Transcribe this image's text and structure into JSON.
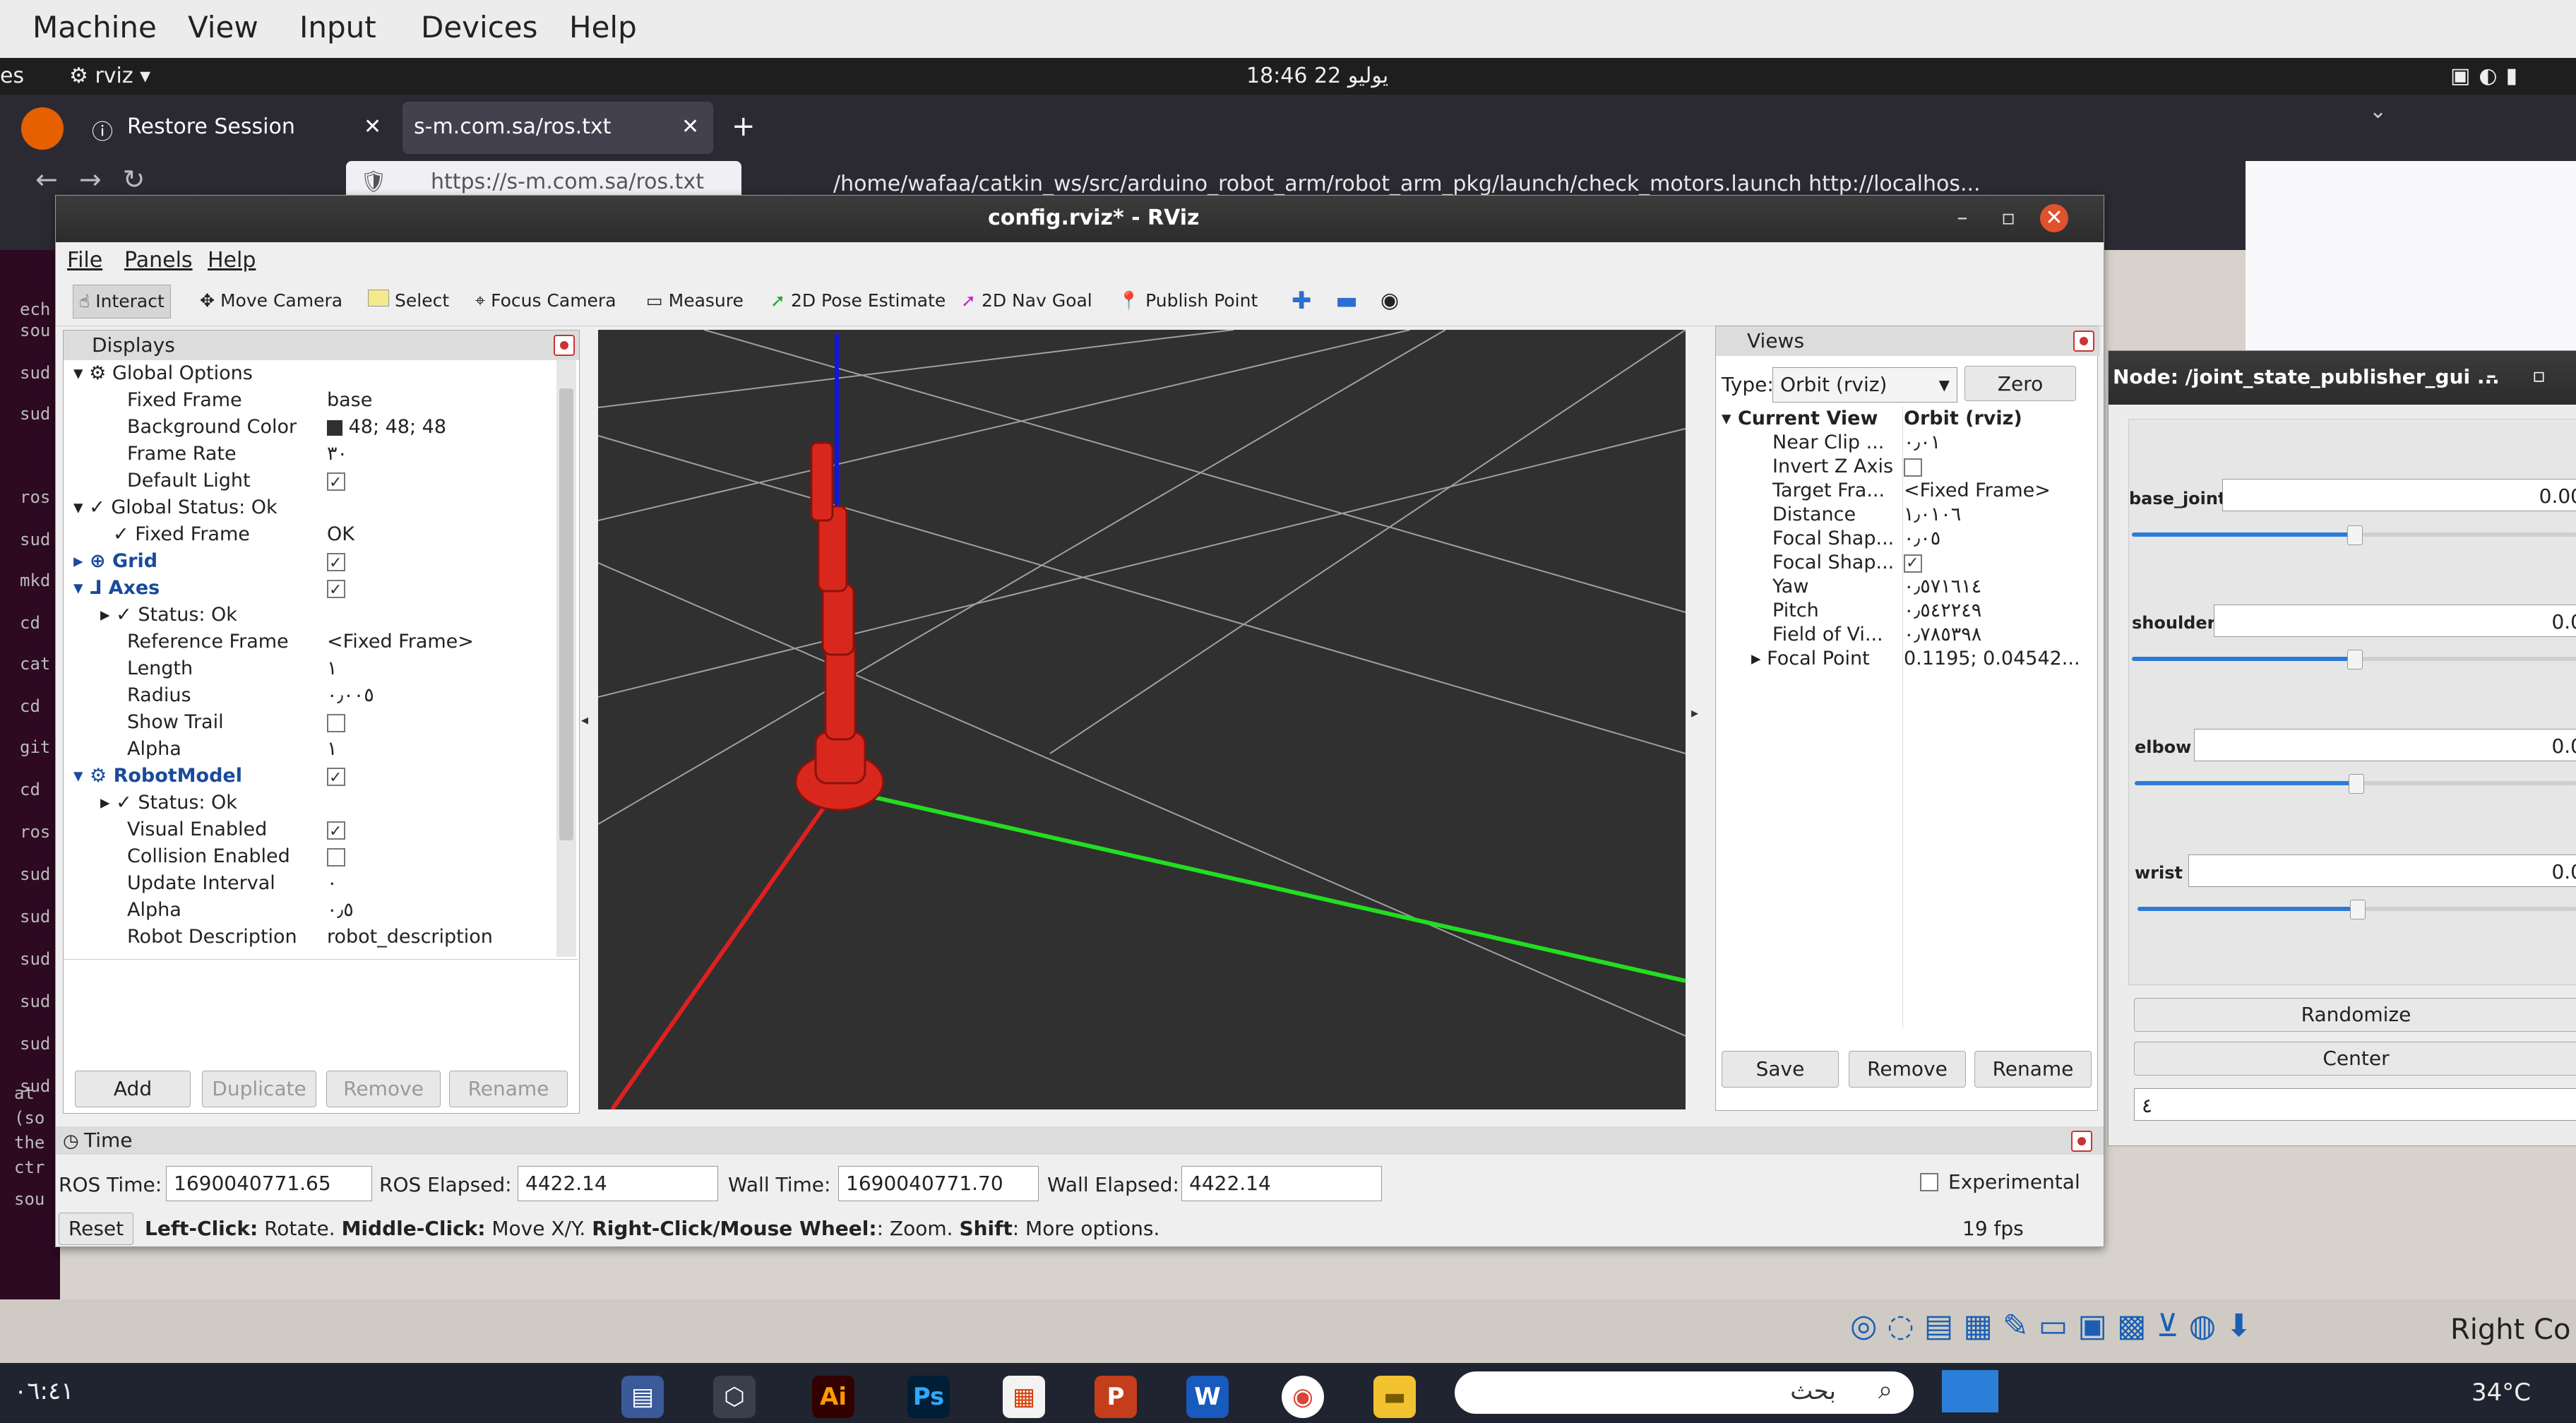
{
  "vm_menu": [
    "Machine",
    "View",
    "Input",
    "Devices",
    "Help"
  ],
  "ubuntu_bar": {
    "left_text": "es",
    "app": "rviz",
    "clock": "18:46 22 يوليو"
  },
  "firefox": {
    "tabs": [
      {
        "label": "Restore Session"
      },
      {
        "label": "s-m.com.sa/ros.txt"
      }
    ],
    "url": "https://s-m.com.sa/ros.txt",
    "path_title": "/home/wafaa/catkin_ws/src/arduino_robot_arm/robot_arm_pkg/launch/check_motors.launch http://localhos..."
  },
  "terminal_lines": [
    "ech",
    "sou",
    "sud",
    "sud",
    "ros",
    "sud",
    "mkd",
    "cd",
    "cat",
    "cd",
    "git",
    "cd",
    "ros",
    "sud",
    "sud",
    "sud",
    "sud",
    "sud",
    "sud",
    "at",
    "(so",
    "the",
    "ctr",
    "sou"
  ],
  "rviz": {
    "title": "config.rviz* - RViz",
    "menu": [
      "File",
      "Panels",
      "Help"
    ],
    "tools": [
      {
        "label": "Interact",
        "icon": "hand-icon"
      },
      {
        "label": "Move Camera",
        "icon": "move-camera-icon"
      },
      {
        "label": "Select",
        "icon": "select-icon"
      },
      {
        "label": "Focus Camera",
        "icon": "focus-icon"
      },
      {
        "label": "Measure",
        "icon": "ruler-icon"
      },
      {
        "label": "2D Pose Estimate",
        "icon": "pose-arrow-icon"
      },
      {
        "label": "2D Nav Goal",
        "icon": "nav-arrow-icon"
      },
      {
        "label": "Publish Point",
        "icon": "pin-icon"
      }
    ],
    "displays": {
      "title": "Displays",
      "rows": [
        {
          "key": "Global Options",
          "value": ""
        },
        {
          "key": "Fixed Frame",
          "value": "base"
        },
        {
          "key": "Background Color",
          "value": "48; 48; 48"
        },
        {
          "key": "Frame Rate",
          "value": "٣٠"
        },
        {
          "key": "Default Light",
          "value": ""
        },
        {
          "key": "Global Status: Ok",
          "value": ""
        },
        {
          "key": "Fixed Frame",
          "value": "OK"
        },
        {
          "key": "Grid",
          "value": ""
        },
        {
          "key": "Axes",
          "value": ""
        },
        {
          "key": "Status: Ok",
          "value": ""
        },
        {
          "key": "Reference Frame",
          "value": "<Fixed Frame>"
        },
        {
          "key": "Length",
          "value": "١"
        },
        {
          "key": "Radius",
          "value": "٠٫٠٠٥"
        },
        {
          "key": "Show Trail",
          "value": ""
        },
        {
          "key": "Alpha",
          "value": "١"
        },
        {
          "key": "RobotModel",
          "value": ""
        },
        {
          "key": "Status: Ok",
          "value": ""
        },
        {
          "key": "Visual Enabled",
          "value": ""
        },
        {
          "key": "Collision Enabled",
          "value": ""
        },
        {
          "key": "Update Interval",
          "value": "٠"
        },
        {
          "key": "Alpha",
          "value": "٠٫٥"
        },
        {
          "key": "Robot Description",
          "value": "robot_description"
        }
      ],
      "buttons": [
        "Add",
        "Duplicate",
        "Remove",
        "Rename"
      ]
    },
    "views": {
      "title": "Views",
      "type_label": "Type:",
      "type_value": "Orbit (rviz)",
      "zero_label": "Zero",
      "rows": [
        {
          "key": "Current View",
          "value": "Orbit (rviz)"
        },
        {
          "key": "Near Clip ...",
          "value": "٠٫٠١"
        },
        {
          "key": "Invert Z Axis",
          "value": ""
        },
        {
          "key": "Target Fra...",
          "value": "<Fixed Frame>"
        },
        {
          "key": "Distance",
          "value": "١٫٠١٠٦"
        },
        {
          "key": "Focal Shap...",
          "value": "٠٫٠٥"
        },
        {
          "key": "Focal Shap...",
          "value": ""
        },
        {
          "key": "Yaw",
          "value": "٠٫٥٧١٦١٤"
        },
        {
          "key": "Pitch",
          "value": "٠٫٥٤٢٢٤٩"
        },
        {
          "key": "Field of Vi...",
          "value": "٠٫٧٨٥٣٩٨"
        },
        {
          "key": "Focal Point",
          "value": "0.1195; 0.04542..."
        }
      ],
      "buttons": [
        "Save",
        "Remove",
        "Rename"
      ]
    },
    "time": {
      "title": "Time",
      "ros_time_label": "ROS Time:",
      "ros_time": "1690040771.65",
      "ros_elapsed_label": "ROS Elapsed:",
      "ros_elapsed": "4422.14",
      "wall_time_label": "Wall Time:",
      "wall_time": "1690040771.70",
      "wall_elapsed_label": "Wall Elapsed:",
      "wall_elapsed": "4422.14",
      "experimental": "Experimental"
    },
    "status": {
      "reset": "Reset",
      "hint_bold1": "Left-Click:",
      "hint1": " Rotate. ",
      "hint_bold2": "Middle-Click:",
      "hint2": " Move X/Y. ",
      "hint_bold3": "Right-Click/Mouse Wheel:",
      "hint3": ": Zoom. ",
      "hint_bold4": "Shift",
      "hint4": ": More options.",
      "fps": "19 fps"
    }
  },
  "joint_publisher": {
    "title": "Node: /joint_state_publisher_gui ...",
    "joints": [
      {
        "name": "base_joint",
        "value": "0.00",
        "level": 0.5
      },
      {
        "name": "shoulder",
        "value": "0.0",
        "level": 0.5
      },
      {
        "name": "elbow",
        "value": "0.0",
        "level": 0.5
      },
      {
        "name": "wrist",
        "value": "0.0",
        "level": 0.5
      }
    ],
    "randomize": "Randomize",
    "center": "Center",
    "count_field": "٤"
  },
  "tray": {
    "right_ctrl": "Right Co"
  },
  "taskbar": {
    "time": "٠٦:٤١",
    "search": "بحث",
    "temp": "34°C",
    "apps": [
      "Ai",
      "Ps",
      "P",
      "W"
    ]
  }
}
